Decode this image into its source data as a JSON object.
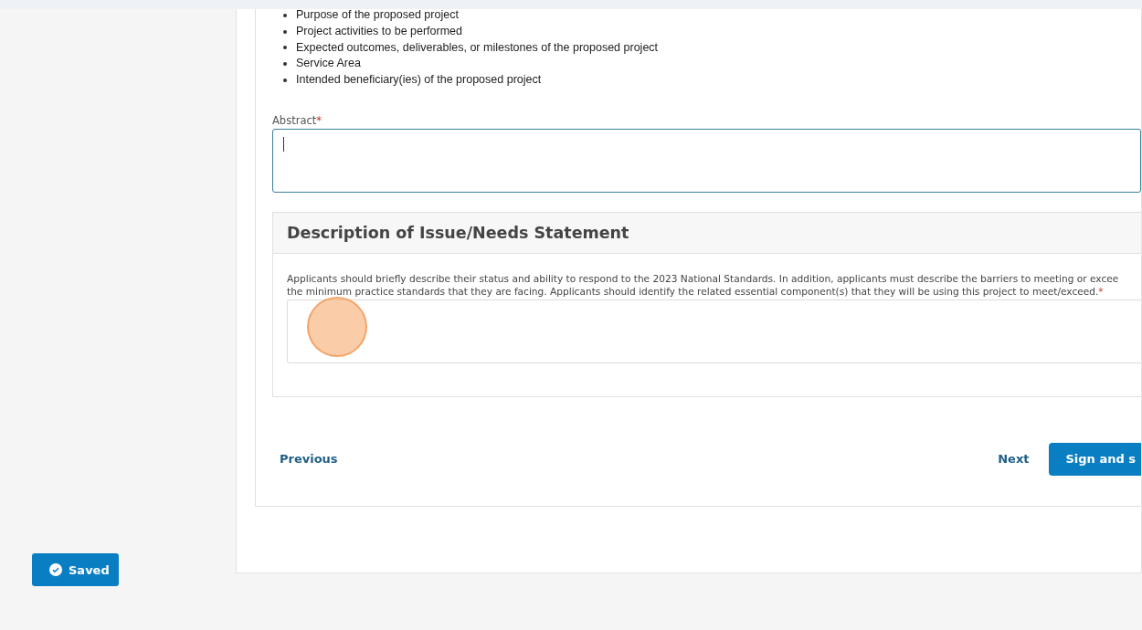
{
  "requirements": [
    "Purpose of the proposed project",
    "Project activities to be performed",
    "Expected outcomes, deliverables, or milestones of the proposed project",
    "Service Area",
    "Intended beneficiary(ies) of the proposed project"
  ],
  "abstract": {
    "label": "Abstract",
    "required_mark": "*",
    "focused": true
  },
  "section": {
    "title": "Description of Issue/Needs Statement",
    "prompt": "Applicants should briefly describe their status and ability to respond to the 2023 National Standards. In addition, applicants must describe the barriers to meeting or excee the minimum practice standards that they are facing. Applicants should identify the related essential component(s) that they will be using this project to meet/exceed.",
    "required_mark": "*"
  },
  "nav": {
    "previous": "Previous",
    "next": "Next",
    "submit": "Sign and s"
  },
  "status": {
    "label": "Saved"
  }
}
